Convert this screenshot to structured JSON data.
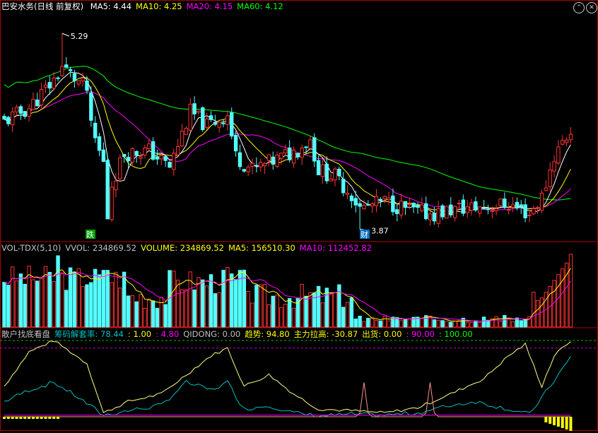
{
  "stock_title": "巴安水务(日线 前复权)",
  "price_header": [
    {
      "label": "MA5: 4.44",
      "color": "#ffffff"
    },
    {
      "label": "MA10: 4.25",
      "color": "#ffff00"
    },
    {
      "label": "MA20: 4.15",
      "color": "#ff00ff"
    },
    {
      "label": "MA60: 4.12",
      "color": "#00ff00"
    }
  ],
  "vol_header": [
    {
      "label": "VOL-TDX(5,10)",
      "color": "#c0c0c0"
    },
    {
      "label": "VVOL: 234869.52",
      "color": "#c0c0c0"
    },
    {
      "label": "VOLUME: 234869.52",
      "color": "#ffff00"
    },
    {
      "label": "MA5: 156510.30",
      "color": "#ffff00"
    },
    {
      "label": "MA10: 112452.82",
      "color": "#ff00ff"
    }
  ],
  "ind_header": [
    {
      "label": "散户找底看盘",
      "color": "#c0c0c0"
    },
    {
      "label": "筹码解套率: 78.44",
      "color": "#00c0c0"
    },
    {
      "label": ": 1.00",
      "color": "#ffff00"
    },
    {
      "label": ": 4.80",
      "color": "#ff00ff"
    },
    {
      "label": "QIDONG: 0.00",
      "color": "#c0c0c0"
    },
    {
      "label": "趋势: 94.80",
      "color": "#ffff00"
    },
    {
      "label": "主力拉高: -30.87",
      "color": "#ffff00"
    },
    {
      "label": "出货: 0.00",
      "color": "#ffff00"
    },
    {
      "label": ": 90.00",
      "color": "#ff00ff"
    },
    {
      "label": ": 100.00",
      "color": "#00ff00"
    }
  ],
  "annotations": {
    "high": "5.29",
    "low": "3.87",
    "mark_die": "跌",
    "mark_cai": "财"
  },
  "colors": {
    "up": "#ff3232",
    "down": "#54ffff",
    "ma5": "#ffffff",
    "ma10": "#ffff00",
    "ma20": "#ff00ff",
    "ma60": "#00ff00",
    "panel_border": "#b00000"
  },
  "chart_data": {
    "type": "candlestick",
    "ylim": [
      3.8,
      5.45
    ],
    "high_value": 5.29,
    "low_value": 3.87,
    "ma_last": {
      "MA5": 4.44,
      "MA10": 4.25,
      "MA20": 4.15,
      "MA60": 4.12
    },
    "volume_last": {
      "VVOL": 234869.52,
      "VOLUME": 234869.52,
      "MA5": 156510.3,
      "MA10": 112452.82
    },
    "indicator_last": {
      "筹码解套率": 78.44,
      "QIDONG": 0.0,
      "趋势": 94.8,
      "主力拉高": -30.87,
      "出货": 0.0
    }
  }
}
